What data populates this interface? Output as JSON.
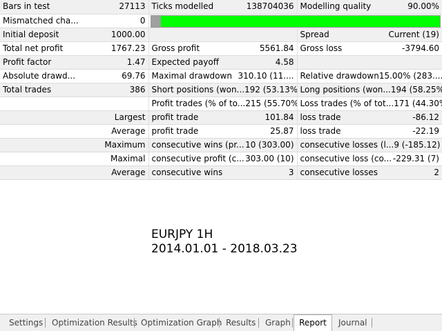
{
  "row1": {
    "bars_label": "Bars in test",
    "bars_value": "27113",
    "ticks_label": "Ticks modelled",
    "ticks_value": "138704036",
    "quality_label": "Modelling quality",
    "quality_value": "90.00%"
  },
  "row2": {
    "mismatch_label": "Mismatched cha...",
    "mismatch_value": "0",
    "quality_fraction": 0.9
  },
  "row3": {
    "deposit_label": "Initial deposit",
    "deposit_value": "1000.00",
    "spread_label": "Spread",
    "spread_value": "Current (19)"
  },
  "row4": {
    "netprofit_label": "Total net profit",
    "netprofit_value": "1767.23",
    "grossprofit_label": "Gross profit",
    "grossprofit_value": "5561.84",
    "grossloss_label": "Gross loss",
    "grossloss_value": "-3794.60"
  },
  "row5": {
    "pf_label": "Profit factor",
    "pf_value": "1.47",
    "payoff_label": "Expected payoff",
    "payoff_value": "4.58"
  },
  "row6": {
    "absdd_label": "Absolute drawd...",
    "absdd_value": "69.76",
    "maxdd_label": "Maximal drawdown",
    "maxdd_value": "310.10 (11....",
    "reldd_label": "Relative drawdown",
    "reldd_value": "15.00% (283...."
  },
  "row7": {
    "trades_label": "Total trades",
    "trades_value": "386",
    "short_label": "Short positions (won...",
    "short_value": "192 (53.13%)",
    "long_label": "Long positions (won...",
    "long_value": "194 (58.25%)"
  },
  "row8": {
    "ptrades_label": "Profit trades (% of to...",
    "ptrades_value": "215 (55.70%)",
    "ltrades_label": "Loss trades (% of tot...",
    "ltrades_value": "171 (44.30%)"
  },
  "row9": {
    "prefix": "Largest",
    "p_label": "profit trade",
    "p_value": "101.84",
    "l_label": "loss trade",
    "l_value": "-86.12"
  },
  "row10": {
    "prefix": "Average",
    "p_label": "profit trade",
    "p_value": "25.87",
    "l_label": "loss trade",
    "l_value": "-22.19"
  },
  "row11": {
    "prefix": "Maximum",
    "p_label": "consecutive wins (pr...",
    "p_value": "10 (303.00)",
    "l_label": "consecutive losses (l...",
    "l_value": "9 (-185.12)"
  },
  "row12": {
    "prefix": "Maximal",
    "p_label": "consecutive profit (c...",
    "p_value": "303.00 (10)",
    "l_label": "consecutive loss (co...",
    "l_value": "-229.31 (7)"
  },
  "row13": {
    "prefix": "Average",
    "p_label": "consecutive wins",
    "p_value": "3",
    "l_label": "consecutive losses",
    "l_value": "2"
  },
  "caption": {
    "line1": "EURJPY 1H",
    "line2": "2014.01.01 - 2018.03.23"
  },
  "tabs": [
    {
      "label": "Settings"
    },
    {
      "label": "Optimization Results"
    },
    {
      "label": "Optimization Graph"
    },
    {
      "label": "Results"
    },
    {
      "label": "Graph"
    },
    {
      "label": "Report"
    },
    {
      "label": "Journal"
    }
  ],
  "active_tab": "Report"
}
